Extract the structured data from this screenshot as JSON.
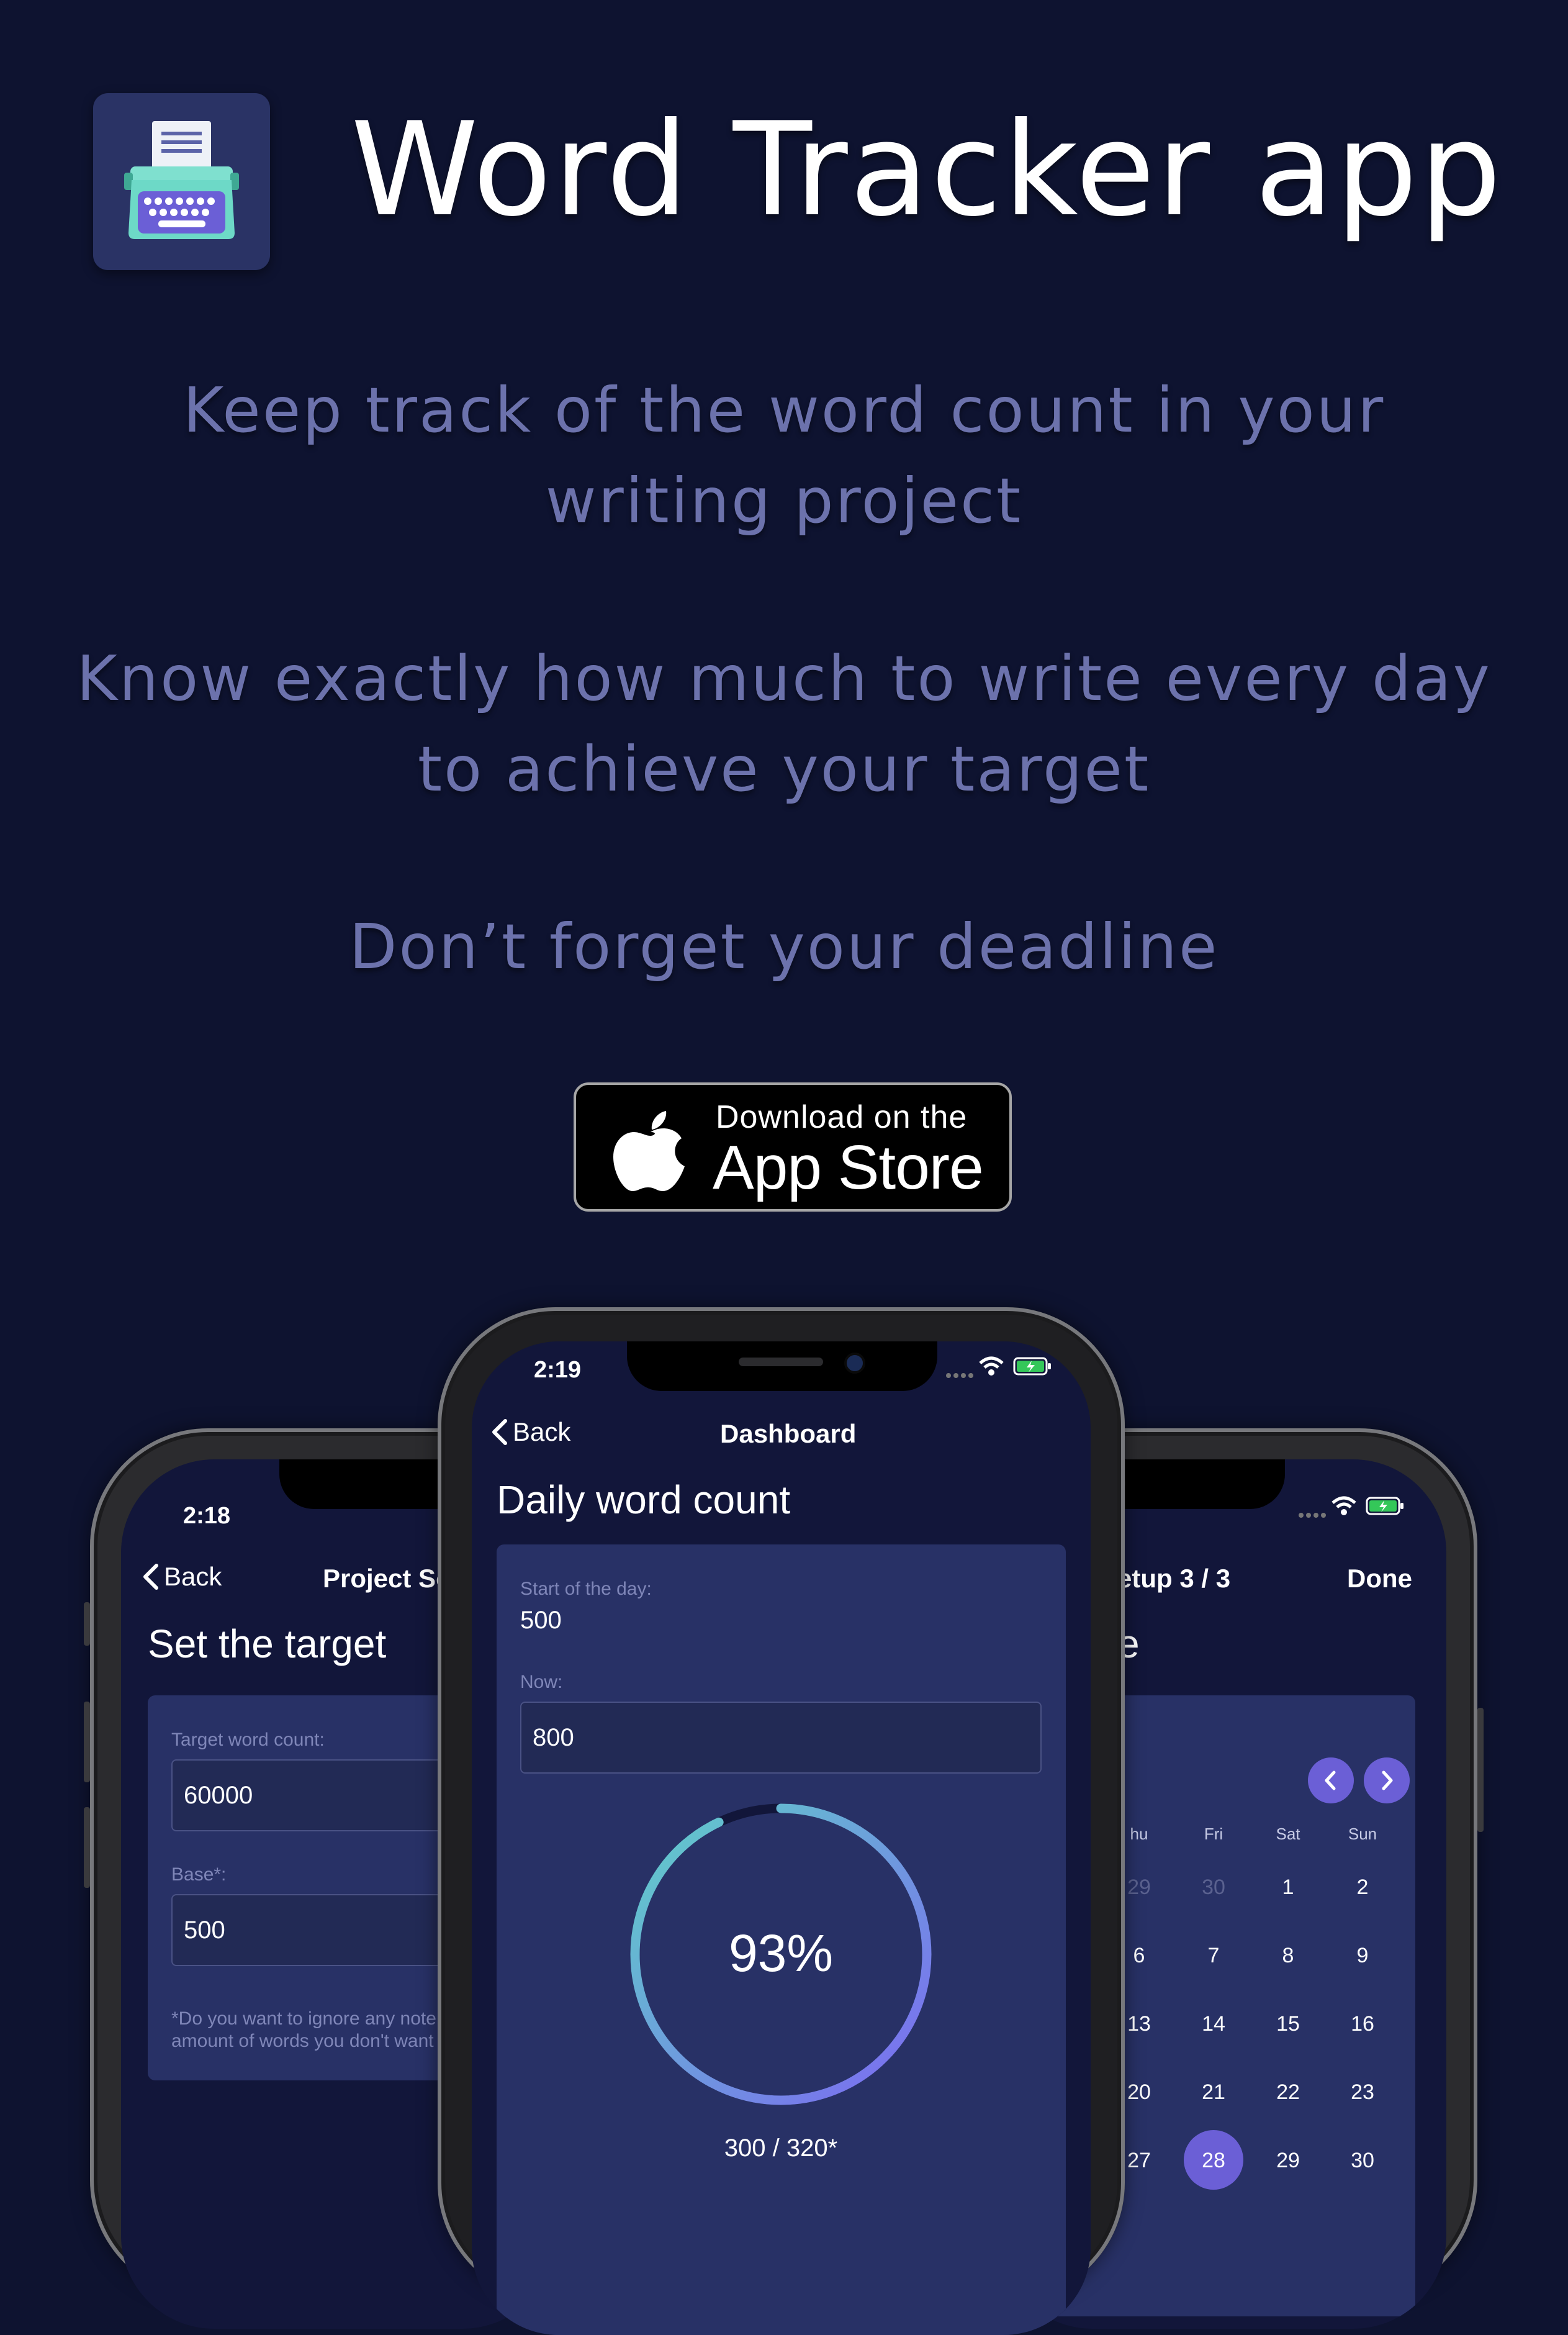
{
  "header": {
    "title": "Word Tracker app",
    "icon": "typewriter-icon"
  },
  "taglines": [
    {
      "line1": "Keep track of the word count in your",
      "line2": "writing project"
    },
    {
      "line1": "Know exactly how much to write every day",
      "line2": "to achieve your target"
    },
    {
      "line1": "Don’t forget your deadline",
      "line2": ""
    }
  ],
  "store_badge": {
    "small_text": "Download on the",
    "big_text": "App Store",
    "icon": "apple-logo-icon"
  },
  "colors": {
    "background": "#0e1330",
    "tagline": "#6c72ac",
    "card": "#283166",
    "accent": "#6b5fd6",
    "ring_start": "#7c68f2",
    "ring_end": "#5fd0c8"
  },
  "phone_left": {
    "status_time": "2:18",
    "back_label": "Back",
    "nav_title": "Project Se",
    "page_title": "Set the target",
    "target_label": "Target word count:",
    "target_value": "60000",
    "base_label": "Base*:",
    "base_value": "500",
    "note_line1": "*Do you want to ignore any note",
    "note_line2": "amount of words you don't want"
  },
  "phone_center": {
    "status_time": "2:19",
    "back_label": "Back",
    "nav_title": "Dashboard",
    "page_title": "Daily word count",
    "start_label": "Start of the day:",
    "start_value": "500",
    "now_label": "Now:",
    "now_value": "800",
    "progress_text": "93%",
    "progress_fraction": 0.93,
    "progress_caption": "300 / 320*"
  },
  "phone_right": {
    "nav_title": "etup 3 / 3",
    "done_label": "Done",
    "page_title_fragment": "e",
    "weekday_headers": [
      "hu",
      "Fri",
      "Sat",
      "Sun"
    ],
    "weeks": [
      [
        "29",
        "30",
        "1",
        "2"
      ],
      [
        "6",
        "7",
        "8",
        "9"
      ],
      [
        "13",
        "14",
        "15",
        "16"
      ],
      [
        "20",
        "21",
        "22",
        "23"
      ],
      [
        "27",
        "28",
        "29",
        "30"
      ]
    ],
    "selected_day": "28"
  }
}
